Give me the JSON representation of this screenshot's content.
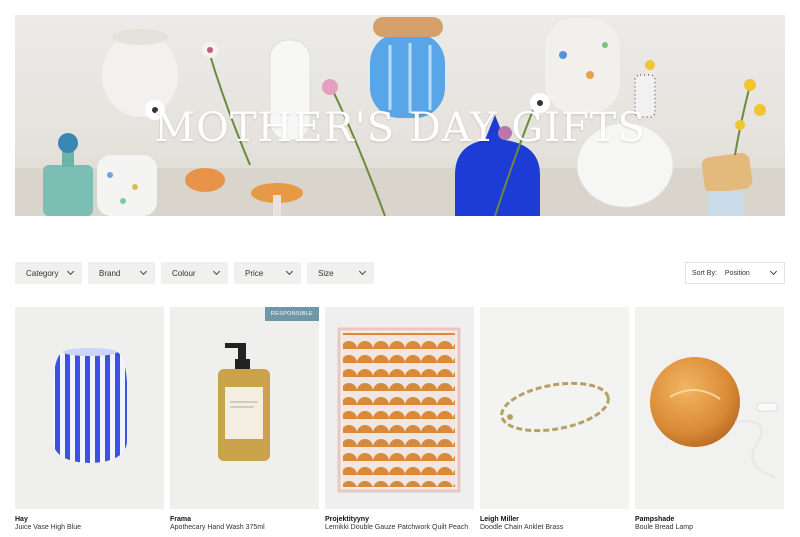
{
  "banner": {
    "title": "MOTHER'S DAY GIFTS"
  },
  "filters": [
    {
      "label": "Category"
    },
    {
      "label": "Brand"
    },
    {
      "label": "Colour"
    },
    {
      "label": "Price"
    },
    {
      "label": "Size"
    }
  ],
  "sort": {
    "label": "Sort By:",
    "value": "Position"
  },
  "products": [
    {
      "brand": "Hay",
      "name": "Juice Vase High Blue",
      "badge": ""
    },
    {
      "brand": "Frama",
      "name": "Apothecary Hand Wash 375ml",
      "badge": "RESPONSIBLE"
    },
    {
      "brand": "Projektityyny",
      "name": "Lemikki Double Gauze Patchwork Quilt Peach",
      "badge": ""
    },
    {
      "brand": "Leigh Miller",
      "name": "Doodle Chain Anklet Brass",
      "badge": ""
    },
    {
      "brand": "Pampshade",
      "name": "Boule Bread Lamp",
      "badge": ""
    }
  ],
  "colors": {
    "badge": "#6f97a6",
    "filter_bg": "#f0f0ef",
    "vase_blue": "#3f4fe0"
  }
}
